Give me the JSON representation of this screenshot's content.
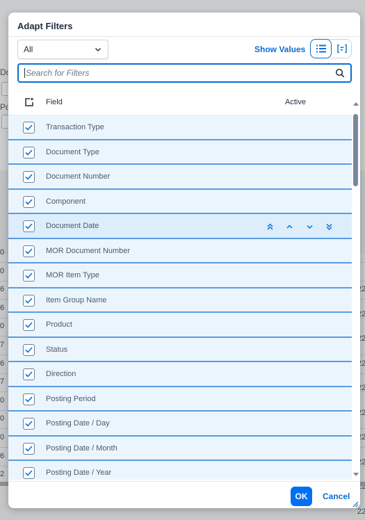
{
  "background": {
    "labels": [
      "Do",
      "Po"
    ],
    "left_values": [
      "0",
      "0",
      "6",
      "6",
      "0",
      "7",
      "6",
      "7",
      "0",
      "0",
      "0",
      "6",
      "2"
    ],
    "right_values": [
      "22",
      "22",
      "22",
      "22",
      "22",
      "22",
      "22",
      "22",
      "22",
      "22"
    ]
  },
  "dialog": {
    "title": "Adapt Filters",
    "toolbar": {
      "select_value": "All",
      "show_values_label": "Show Values",
      "view_list_icon": "list-icon",
      "view_group_icon": "group-view-icon"
    },
    "search": {
      "placeholder": "Search for Filters",
      "value": "",
      "icon": "search-icon"
    },
    "table": {
      "columns": {
        "field": "Field",
        "active": "Active"
      },
      "rows": [
        {
          "label": "Transaction Type",
          "checked": true
        },
        {
          "label": "Document Type",
          "checked": true
        },
        {
          "label": "Document Number",
          "checked": true
        },
        {
          "label": "Component",
          "checked": true
        },
        {
          "label": "Document Date",
          "checked": true,
          "hovered": true
        },
        {
          "label": "MOR Document Number",
          "checked": true
        },
        {
          "label": "MOR Item Type",
          "checked": true
        },
        {
          "label": "Item Group Name",
          "checked": true
        },
        {
          "label": "Product",
          "checked": true
        },
        {
          "label": "Status",
          "checked": true
        },
        {
          "label": "Direction",
          "checked": true
        },
        {
          "label": "Posting Period",
          "checked": true
        },
        {
          "label": "Posting Date / Day",
          "checked": true
        },
        {
          "label": "Posting Date / Month",
          "checked": true
        },
        {
          "label": "Posting Date / Year",
          "checked": true
        }
      ],
      "move_buttons": [
        "move-to-top",
        "move-up",
        "move-down",
        "move-to-bottom"
      ]
    },
    "footer": {
      "ok_label": "OK",
      "cancel_label": "Cancel"
    },
    "colors": {
      "accent": "#0a6ed1",
      "ok_button": "#0070f2",
      "row_background": "#ebf5fe",
      "row_divider": "#5a9be0"
    }
  }
}
